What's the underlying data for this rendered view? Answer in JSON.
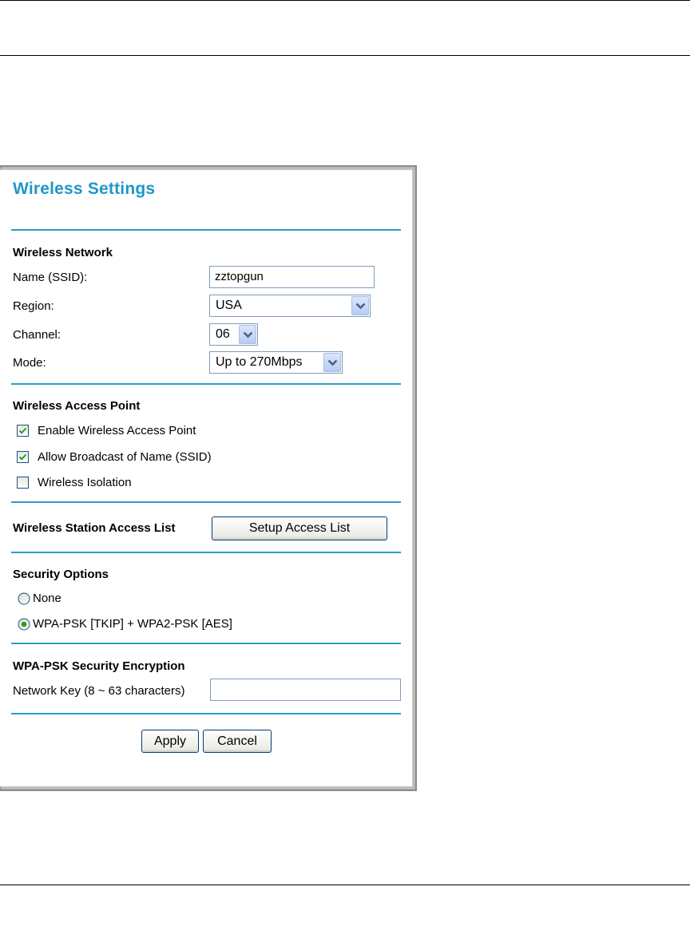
{
  "title": "Wireless Settings",
  "wireless_network": {
    "heading": "Wireless Network",
    "name_label": "Name (SSID):",
    "name_value": "zztopgun",
    "region_label": "Region:",
    "region_value": "USA",
    "channel_label": "Channel:",
    "channel_value": "06",
    "mode_label": "Mode:",
    "mode_value": "Up to 270Mbps"
  },
  "access_point": {
    "heading": "Wireless Access Point",
    "options": [
      {
        "label": "Enable Wireless Access Point",
        "checked": true
      },
      {
        "label": "Allow Broadcast of Name (SSID)",
        "checked": true
      },
      {
        "label": "Wireless Isolation",
        "checked": false
      }
    ]
  },
  "station_access": {
    "heading": "Wireless Station Access List",
    "button_label": "Setup Access List"
  },
  "security": {
    "heading": "Security Options",
    "options": [
      {
        "label": "None",
        "selected": false
      },
      {
        "label": "WPA-PSK [TKIP] + WPA2-PSK [AES]",
        "selected": true
      }
    ]
  },
  "encryption": {
    "heading": "WPA-PSK Security Encryption",
    "key_label": "Network Key (8 ~ 63 characters)",
    "key_value": ""
  },
  "actions": {
    "apply_label": "Apply",
    "cancel_label": "Cancel"
  },
  "colors": {
    "title": "#1f96c9",
    "divider": "#2a9ccd"
  }
}
